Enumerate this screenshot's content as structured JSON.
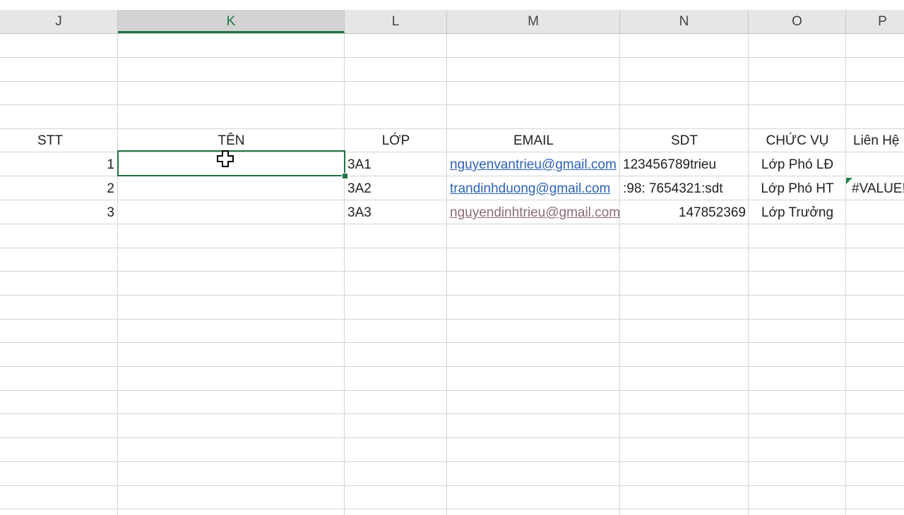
{
  "columns": [
    {
      "letter": "J"
    },
    {
      "letter": "K"
    },
    {
      "letter": "L"
    },
    {
      "letter": "M"
    },
    {
      "letter": "N"
    },
    {
      "letter": "O"
    },
    {
      "letter": "P"
    }
  ],
  "selected_column": "K",
  "table": {
    "headers": {
      "stt": "STT",
      "ten": "TÊN",
      "lop": "LỚP",
      "email": "EMAIL",
      "sdt": "SDT",
      "chuc_vu": "CHỨC VỤ",
      "lien_he": "Liên Hệ"
    },
    "rows": [
      {
        "stt": "1",
        "ten": "",
        "lop": "3A1",
        "email": "nguyenvantrieu@gmail.com",
        "sdt": "123456789trieu",
        "chuc_vu": "Lớp Phó LĐ",
        "lien_he": ""
      },
      {
        "stt": "2",
        "ten": "",
        "lop": "3A2",
        "email": "trandinhduong@gmail.com",
        "sdt": ":98: 7654321:sdt",
        "chuc_vu": "Lớp Phó HT",
        "lien_he": "#VALUE!"
      },
      {
        "stt": "3",
        "ten": "",
        "lop": "3A3",
        "email": "nguyendinhtrieu@gmail.com",
        "sdt": "147852369",
        "chuc_vu": "Lớp Trưởng",
        "lien_he": ""
      }
    ]
  },
  "icons": {
    "cursor": "excel-plus-cursor-icon",
    "error_flag": "error-indicator-triangle-icon"
  },
  "colors": {
    "selection": "#217346",
    "link": "#2e62b7",
    "visited_link": "#8c6b73"
  }
}
